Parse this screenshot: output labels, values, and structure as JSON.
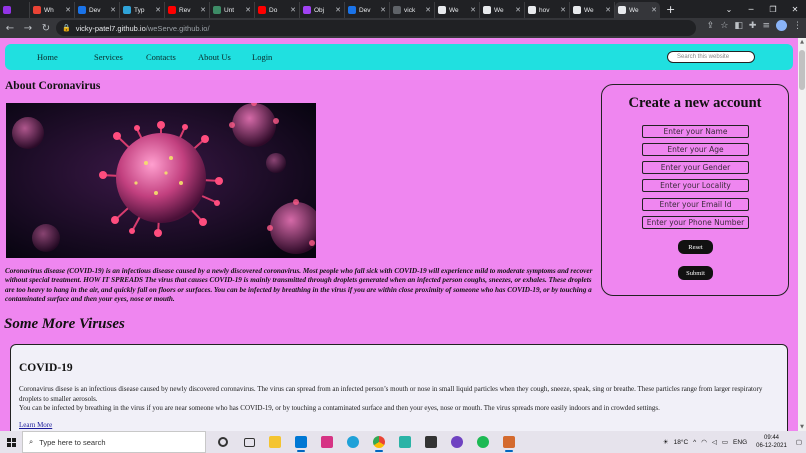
{
  "browser": {
    "tabs": [
      {
        "title": "",
        "color": "#9334e6"
      },
      {
        "title": "Wh",
        "color": "#ea4335"
      },
      {
        "title": "Dev",
        "color": "#1a73e8"
      },
      {
        "title": "Typ",
        "color": "#2fa3d8"
      },
      {
        "title": "Rev",
        "color": "#ff0000"
      },
      {
        "title": "Unt",
        "color": "#3d8b66"
      },
      {
        "title": "Do",
        "color": "#ff0000"
      },
      {
        "title": "Obj",
        "color": "#a142f4"
      },
      {
        "title": "Dev",
        "color": "#1a73e8"
      },
      {
        "title": "vick",
        "color": "#5f6368"
      },
      {
        "title": "We",
        "color": "#e8eaed"
      },
      {
        "title": "We",
        "color": "#e8eaed"
      },
      {
        "title": "hov",
        "color": "#e8eaed"
      },
      {
        "title": "We",
        "color": "#e8eaed"
      },
      {
        "title": "We",
        "color": "#e8eaed",
        "active": true
      }
    ],
    "url_host": "vicky-patel7.github.io",
    "url_path": "/weServe.github.io/"
  },
  "nav": {
    "links": [
      "Home",
      "Services",
      "Contacts",
      "About Us",
      "Login"
    ],
    "search_placeholder": "Search this website"
  },
  "about": {
    "title": "About Coronavirus",
    "text": "Coronavirus disease (COVID-19) is an infectious disease caused by a newly discovered coronavirus. Most people who fall sick with COVID-19 will experience mild to moderate symptoms and recover without special treatment. HOW IT SPREADS The virus that causes COVID-19 is mainly transmitted through droplets generated when an infected person coughs, sneezes, or exhales. These droplets are too heavy to hang in the air, and quickly fall on floors or surfaces. You can be infected by breathing in the virus if you are within close proximity of someone who has COVID-19, or by touching a contaminated surface and then your eyes, nose or mouth."
  },
  "signup": {
    "title": "Create a new account",
    "placeholders": {
      "name": "Enter your Name",
      "age": "Enter your Age",
      "gender": "Enter your Gender",
      "locality": "Enter your Locality",
      "email": "Enter your Email Id",
      "phone": "Enter your Phone Number"
    },
    "reset_label": "Reset",
    "submit_label": "Submit"
  },
  "more": {
    "title": "Some More Viruses",
    "card": {
      "title": "COVID-19",
      "line1": "Coronavirus disese is an infectious disease caused by newly discovered coronavirus. The virus can spread from an infected person’s mouth or nose in small liquid particles when they cough, sneeze, speak, sing or breathe. These particles range from larger respiratory droplets to smaller aerosols.",
      "line2": "You can be infected by breathing in the virus if you are near someone who has COVID-19, or by touching a contaminated surface and then your eyes, nose or mouth. The virus spreads more easily indoors and in crowded settings.",
      "link": "Learn More"
    }
  },
  "taskbar": {
    "search_placeholder": "Type here to search",
    "weather": "18°C",
    "language": "ENG",
    "time": "09:44",
    "date": "06-12-2021"
  },
  "colors": {
    "page_bg": "#ef86f0",
    "navbar_bg": "#20e0e0",
    "card_bg": "#f1f0f8"
  }
}
